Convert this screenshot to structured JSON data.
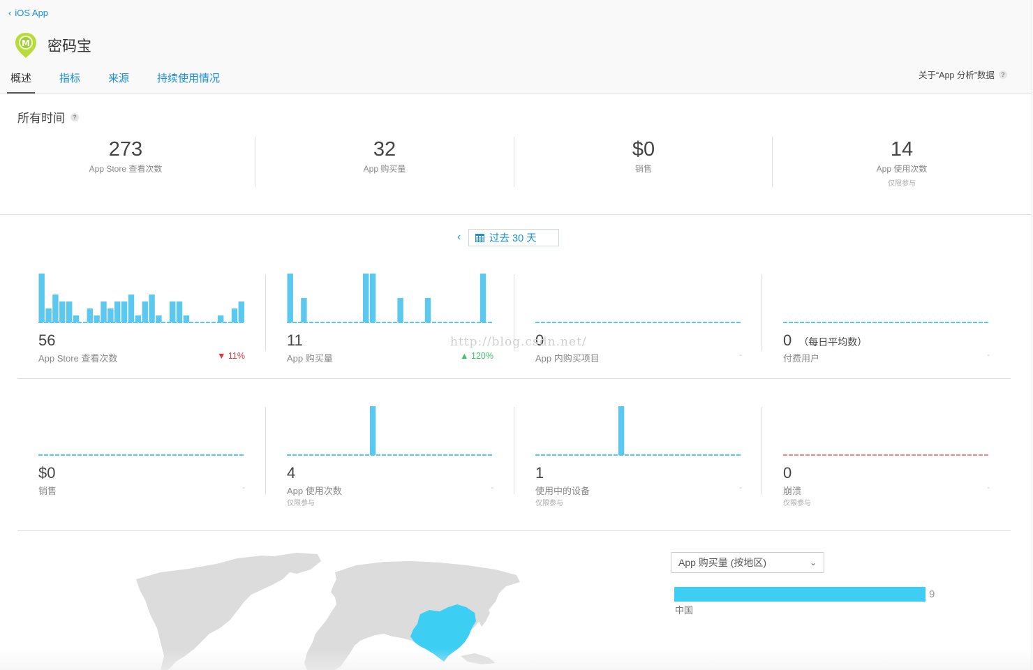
{
  "header": {
    "back_label": "iOS App",
    "app_name": "密码宝",
    "tabs": [
      {
        "label": "概述"
      },
      {
        "label": "指标"
      },
      {
        "label": "来源"
      },
      {
        "label": "持续使用情况"
      }
    ],
    "about_label": "关于“App 分析”数据",
    "about_help": "?"
  },
  "all_time": {
    "title": "所有时间",
    "help": "?",
    "summary": [
      {
        "value": "273",
        "label": "App Store 查看次数",
        "sub": ""
      },
      {
        "value": "32",
        "label": "App 购买量",
        "sub": ""
      },
      {
        "value": "$0",
        "label": "销售",
        "sub": ""
      },
      {
        "value": "14",
        "label": "App 使用次数",
        "sub": "仅限参与"
      }
    ]
  },
  "period": {
    "prev": "‹",
    "label": "过去 30 天"
  },
  "metrics": [
    {
      "value": "56",
      "suffix": "",
      "label": "App Store 查看次数",
      "sub": "",
      "change": "▼ 11%",
      "change_color": "#e0393e",
      "dash": "",
      "line_color": "#5bc8f0",
      "bars": [
        7,
        2,
        4,
        3,
        3,
        1,
        0,
        2,
        1,
        3,
        2,
        3,
        3,
        4,
        1,
        3,
        4,
        1,
        0,
        3,
        3,
        1,
        0,
        0,
        0,
        0,
        1,
        0,
        2,
        3
      ]
    },
    {
      "value": "11",
      "suffix": "",
      "label": "App 购买量",
      "sub": "",
      "change": "▲ 120%",
      "change_color": "#3cc36a",
      "dash": "",
      "line_color": "#5bc8f0",
      "bars": [
        2,
        0,
        1,
        0,
        0,
        0,
        0,
        0,
        0,
        0,
        0,
        2,
        2,
        0,
        0,
        0,
        1,
        0,
        0,
        0,
        1,
        0,
        0,
        0,
        0,
        0,
        0,
        0,
        2,
        0
      ]
    },
    {
      "value": "0",
      "suffix": "",
      "label": "App 内购买项目",
      "sub": "",
      "change": "",
      "change_color": "",
      "dash": "-",
      "line_color": "#5bc8f0",
      "bars": []
    },
    {
      "value": "0",
      "suffix": "（每日平均数）",
      "label": "付费用户",
      "sub": "",
      "change": "",
      "change_color": "",
      "dash": "-",
      "line_color": "#5bc8f0",
      "bars": []
    },
    {
      "value": "$0",
      "suffix": "",
      "label": "销售",
      "sub": "",
      "change": "",
      "change_color": "",
      "dash": "-",
      "line_color": "#5bc8f0",
      "bars": []
    },
    {
      "value": "4",
      "suffix": "",
      "label": "App 使用次数",
      "sub": "仅限参与",
      "change": "",
      "change_color": "",
      "dash": "-",
      "line_color": "#5bc8f0",
      "bars": [
        0,
        0,
        0,
        0,
        0,
        0,
        0,
        0,
        0,
        0,
        0,
        0,
        1,
        0,
        0,
        0,
        0,
        0,
        0,
        0,
        0,
        0,
        0,
        0,
        0,
        0,
        0,
        0,
        0,
        0
      ]
    },
    {
      "value": "1",
      "suffix": "",
      "label": "使用中的设备",
      "sub": "仅限参与",
      "change": "",
      "change_color": "",
      "dash": "-",
      "line_color": "#5bc8f0",
      "bars": [
        0,
        0,
        0,
        0,
        0,
        0,
        0,
        0,
        0,
        0,
        0,
        0,
        1,
        0,
        0,
        0,
        0,
        0,
        0,
        0,
        0,
        0,
        0,
        0,
        0,
        0,
        0,
        0,
        0,
        0
      ]
    },
    {
      "value": "0",
      "suffix": "",
      "label": "崩溃",
      "sub": "仅限参与",
      "change": "",
      "change_color": "",
      "dash": "-",
      "line_color": "#f08a8a",
      "bars": []
    }
  ],
  "region": {
    "select_label": "App 购买量 (按地区)",
    "rows": [
      {
        "name": "中国",
        "value": 9
      }
    ],
    "max": 9
  },
  "watermark": "http://blog.csdn.net/",
  "colors": {
    "link": "#1a8fd6",
    "bar": "#5bc8f0",
    "highlight": "#3ccff3"
  }
}
